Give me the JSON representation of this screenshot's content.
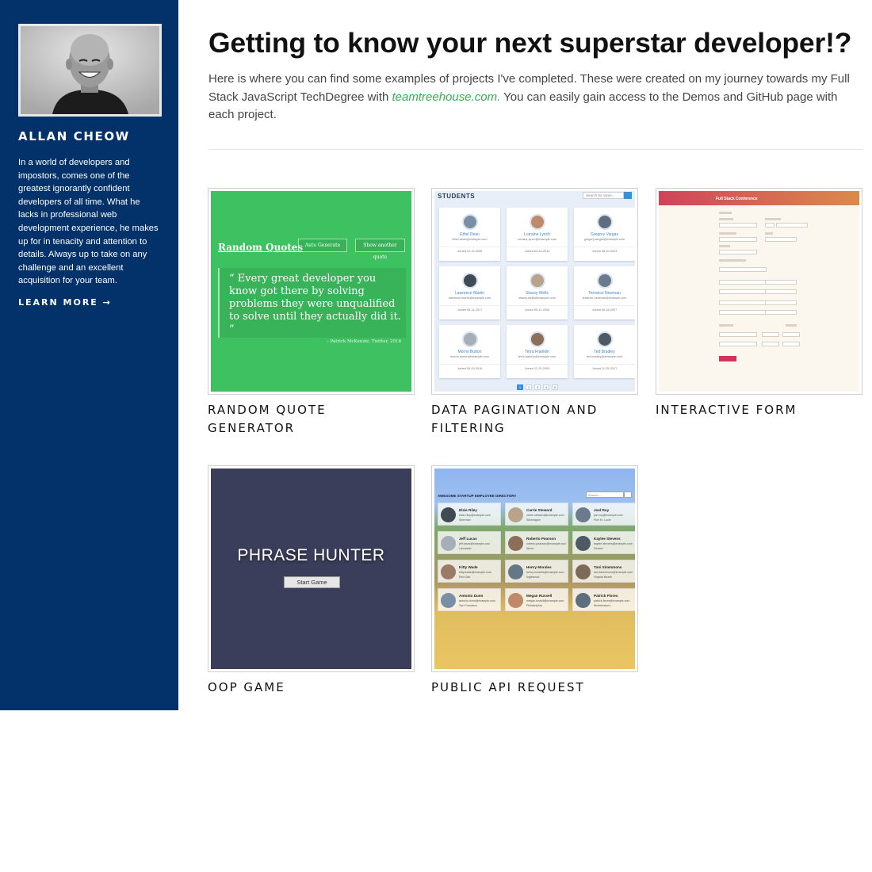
{
  "sidebar": {
    "name": "ALLAN CHEOW",
    "bio": "In a world of developers and impostors, comes one of the greatest ignorantly confident developers of all time. What he lacks in professional web development experience, he makes up for in tenacity and attention to details. Always up to take on any challenge and an excellent acquisition for your team.",
    "learn_more": "LEARN MORE →"
  },
  "main": {
    "headline": "Getting to know your next superstar developer!?",
    "intro_before": "Here is where you can find some examples of projects I've completed. These were created on my journey towards my Full Stack JavaScript TechDegree with ",
    "intro_link": "teamtreehouse.com.",
    "intro_after": " You can easily gain access to the Demos and GitHub page with each project."
  },
  "projects": [
    {
      "title": "RANDOM QUOTE GENERATOR",
      "screenshot": {
        "heading": "Random Quotes",
        "button_1": "Auto Generate",
        "button_2": "Show another quote",
        "quote_mark": "“",
        "quote": "Every great developer you know got there by solving problems they were unqualified to solve until they actually did it.",
        "quote_end": "”",
        "citation": "– Patrick McKenzie, Twitter, 2016",
        "bg_color": "#3ec161"
      }
    },
    {
      "title": "DATA PAGINATION AND FILTERING",
      "screenshot": {
        "heading": "STUDENTS",
        "search_placeholder": "Search by name...",
        "students": [
          {
            "name": "Ethel Dean",
            "email": "ethel.dean@example.com",
            "joined": "Joined 12-15-2005"
          },
          {
            "name": "Lorraine Lynch",
            "email": "lorraine.lynch@example.com",
            "joined": "Joined 02-24-2013"
          },
          {
            "name": "Gregory Vargas",
            "email": "gregory.vargas@example.com",
            "joined": "Joined 05-20-2013"
          },
          {
            "name": "Lawrence Martin",
            "email": "lawrence.martin@example.com",
            "joined": "Joined 06-11-2017"
          },
          {
            "name": "Stacey Wells",
            "email": "stacey.wells@example.com",
            "joined": "Joined 09-12-2004"
          },
          {
            "name": "Terrance Newman",
            "email": "terrance.newman@example.com",
            "joined": "Joined 06-26-2007"
          },
          {
            "name": "Morris Burton",
            "email": "morris.burton@example.com",
            "joined": "Joined 09-09-2016"
          },
          {
            "name": "Terra Franklin",
            "email": "terra.franklin@example.com",
            "joined": "Joined 12-20-2009"
          },
          {
            "name": "Ted Bradley",
            "email": "ted.bradley@example.com",
            "joined": "Joined 11-25-2017"
          }
        ],
        "pages": [
          "1",
          "2",
          "3",
          "4",
          "5"
        ],
        "current_page": "1"
      }
    },
    {
      "title": "INTERACTIVE FORM",
      "screenshot": {
        "header_title": "Full Stack Conference",
        "header_color_start": "#d0435b",
        "header_color_end": "#db8a4c"
      }
    },
    {
      "title": "OOP GAME",
      "screenshot": {
        "heading": "PHRASE HUNTER",
        "button": "Start Game",
        "bg_color": "#3b3e5a"
      }
    },
    {
      "title": "PUBLIC API REQUEST",
      "screenshot": {
        "heading": "AWESOME STARTUP EMPLOYEE DIRECTORY",
        "search_placeholder": "Search...",
        "employees": [
          {
            "name": "Elsie Riley",
            "email": "elsie.riley@example.com",
            "city": "Sherman"
          },
          {
            "name": "Carrie Steward",
            "email": "carrie.steward@example.com",
            "city": "Wilmington"
          },
          {
            "name": "Joel Roy",
            "email": "joel.roy@example.com",
            "city": "Port St. Lucie"
          },
          {
            "name": "Jeff Lucas",
            "email": "jeff.lucas@example.com",
            "city": "Lancaster"
          },
          {
            "name": "Roberto Pearson",
            "email": "roberto.pearson@example.com",
            "city": "Akron"
          },
          {
            "name": "Kaylee Stevens",
            "email": "kaylee.stevens@example.com",
            "city": "Denton"
          },
          {
            "name": "Kitty Wade",
            "email": "kitty.wade@example.com",
            "city": "Red Oak"
          },
          {
            "name": "Henry Morales",
            "email": "henry.morales@example.com",
            "city": "Inglewood"
          },
          {
            "name": "Toni Simmmons",
            "email": "toni.simmmons@example.com",
            "city": "Virginia Beach"
          },
          {
            "name": "Antonio Dunn",
            "email": "antonio.dunn@example.com",
            "city": "San Francisco"
          },
          {
            "name": "Megan Russell",
            "email": "megan.russell@example.com",
            "city": "Philadelphia"
          },
          {
            "name": "Patrick Flores",
            "email": "patrick.flores@example.com",
            "city": "Murfreesboro"
          }
        ]
      }
    }
  ]
}
